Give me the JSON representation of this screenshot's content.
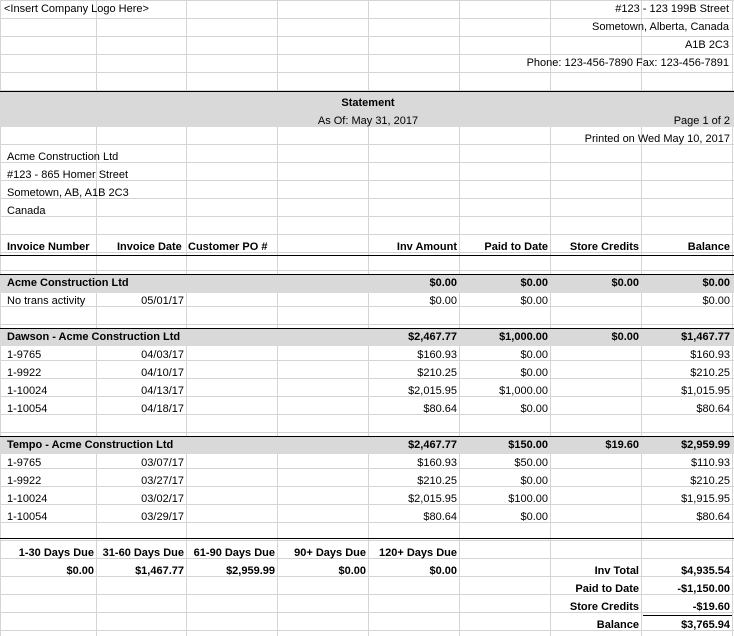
{
  "company": {
    "logo_placeholder": "<Insert Company Logo Here>",
    "address_line1": "#123 - 123 199B Street",
    "address_line2": "Sometown, Alberta, Canada",
    "postal": "A1B 2C3",
    "contact": "Phone: 123-456-7890 Fax: 123-456-7891"
  },
  "statement": {
    "title": "Statement",
    "as_of": "As Of: May 31, 2017",
    "page": "Page 1 of 2",
    "printed": "Printed on Wed May 10, 2017"
  },
  "customer": {
    "name": "Acme Construction Ltd",
    "street": "#123 - 865 Homer Street",
    "city": "Sometown, AB, A1B 2C3",
    "country": "Canada"
  },
  "columns": {
    "invoice_number": "Invoice Number",
    "invoice_date": "Invoice Date",
    "customer_po": "Customer PO #",
    "inv_amount": "Inv Amount",
    "paid_to_date": "Paid to Date",
    "store_credits": "Store Credits",
    "balance": "Balance"
  },
  "groups": [
    {
      "name": "Acme Construction Ltd",
      "inv_amount": "$0.00",
      "paid": "$0.00",
      "credits": "$0.00",
      "balance": "$0.00",
      "rows": [
        {
          "number": "No trans activity",
          "date": "05/01/17",
          "amount": "$0.00",
          "paid": "$0.00",
          "balance": "$0.00"
        }
      ]
    },
    {
      "name": "Dawson - Acme Construction Ltd",
      "inv_amount": "$2,467.77",
      "paid": "$1,000.00",
      "credits": "$0.00",
      "balance": "$1,467.77",
      "rows": [
        {
          "number": "1-9765",
          "date": "04/03/17",
          "amount": "$160.93",
          "paid": "$0.00",
          "balance": "$160.93"
        },
        {
          "number": "1-9922",
          "date": "04/10/17",
          "amount": "$210.25",
          "paid": "$0.00",
          "balance": "$210.25"
        },
        {
          "number": "1-10024",
          "date": "04/13/17",
          "amount": "$2,015.95",
          "paid": "$1,000.00",
          "balance": "$1,015.95"
        },
        {
          "number": "1-10054",
          "date": "04/18/17",
          "amount": "$80.64",
          "paid": "$0.00",
          "balance": "$80.64"
        }
      ]
    },
    {
      "name": "Tempo - Acme Construction Ltd",
      "inv_amount": "$2,467.77",
      "paid": "$150.00",
      "credits": "$19.60",
      "balance": "$2,959.99",
      "rows": [
        {
          "number": "1-9765",
          "date": "03/07/17",
          "amount": "$160.93",
          "paid": "$50.00",
          "balance": "$110.93"
        },
        {
          "number": "1-9922",
          "date": "03/27/17",
          "amount": "$210.25",
          "paid": "$0.00",
          "balance": "$210.25"
        },
        {
          "number": "1-10024",
          "date": "03/02/17",
          "amount": "$2,015.95",
          "paid": "$100.00",
          "balance": "$1,915.95"
        },
        {
          "number": "1-10054",
          "date": "03/29/17",
          "amount": "$80.64",
          "paid": "$0.00",
          "balance": "$80.64"
        }
      ]
    }
  ],
  "aging": {
    "headers": [
      "1-30 Days Due",
      "31-60 Days Due",
      "61-90 Days Due",
      "90+ Days Due",
      "120+ Days Due"
    ],
    "values": [
      "$0.00",
      "$1,467.77",
      "$2,959.99",
      "$0.00",
      "$0.00"
    ]
  },
  "totals": [
    {
      "label": "Inv Total",
      "value": "$4,935.54"
    },
    {
      "label": "Paid to Date",
      "value": "-$1,150.00"
    },
    {
      "label": "Store Credits",
      "value": "-$19.60"
    },
    {
      "label": "Balance",
      "value": "$3,765.94"
    }
  ]
}
